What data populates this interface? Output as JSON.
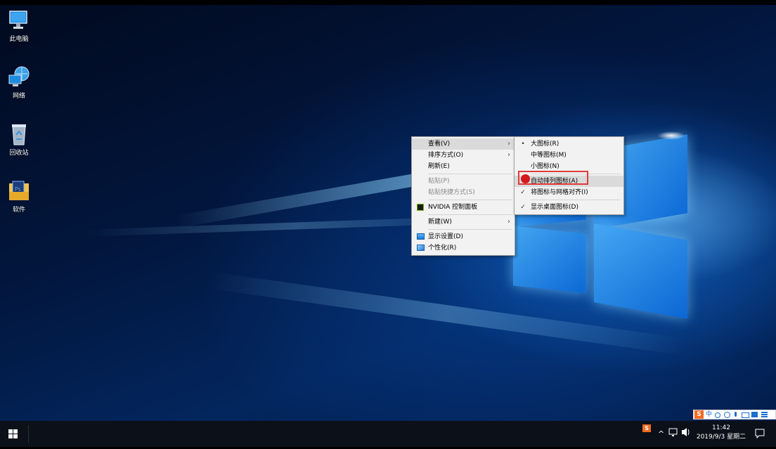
{
  "desktop": {
    "icons": [
      {
        "label": "此电脑",
        "icon": "computer-icon"
      },
      {
        "label": "网络",
        "icon": "network-icon"
      },
      {
        "label": "回收站",
        "icon": "recycle-bin-icon"
      },
      {
        "label": "软件",
        "icon": "folder-icon"
      }
    ]
  },
  "context_menu": {
    "items": [
      {
        "label": "查看(V)",
        "submenu": true
      },
      {
        "label": "排序方式(O)",
        "submenu": true
      },
      {
        "label": "刷新(E)"
      },
      {
        "label": "粘贴(P)",
        "disabled": true
      },
      {
        "label": "粘贴快捷方式(S)",
        "disabled": true
      },
      {
        "label": "NVIDIA 控制面板",
        "icon": "nvidia-icon"
      },
      {
        "label": "新建(W)",
        "submenu": true
      },
      {
        "label": "显示设置(D)",
        "icon": "display-settings-icon"
      },
      {
        "label": "个性化(R)",
        "icon": "personalize-icon"
      }
    ]
  },
  "view_submenu": {
    "items": [
      {
        "label": "大图标(R)",
        "state": "selected"
      },
      {
        "label": "中等图标(M)"
      },
      {
        "label": "小图标(N)"
      },
      {
        "label": "自动排列图标(A)",
        "highlighted": true
      },
      {
        "label": "将图标与网格对齐(I)",
        "state": "checked"
      },
      {
        "label": "显示桌面图标(D)",
        "state": "checked"
      }
    ],
    "bullet": "•",
    "check": "✓"
  },
  "taskbar": {
    "time": "11:42",
    "date": "2019/9/3 星期二",
    "ime_lang": "中"
  },
  "colors": {
    "highlight_box": "#e23b3b",
    "cursor_dot": "#d41a1a",
    "taskbar": "#0c1018"
  }
}
